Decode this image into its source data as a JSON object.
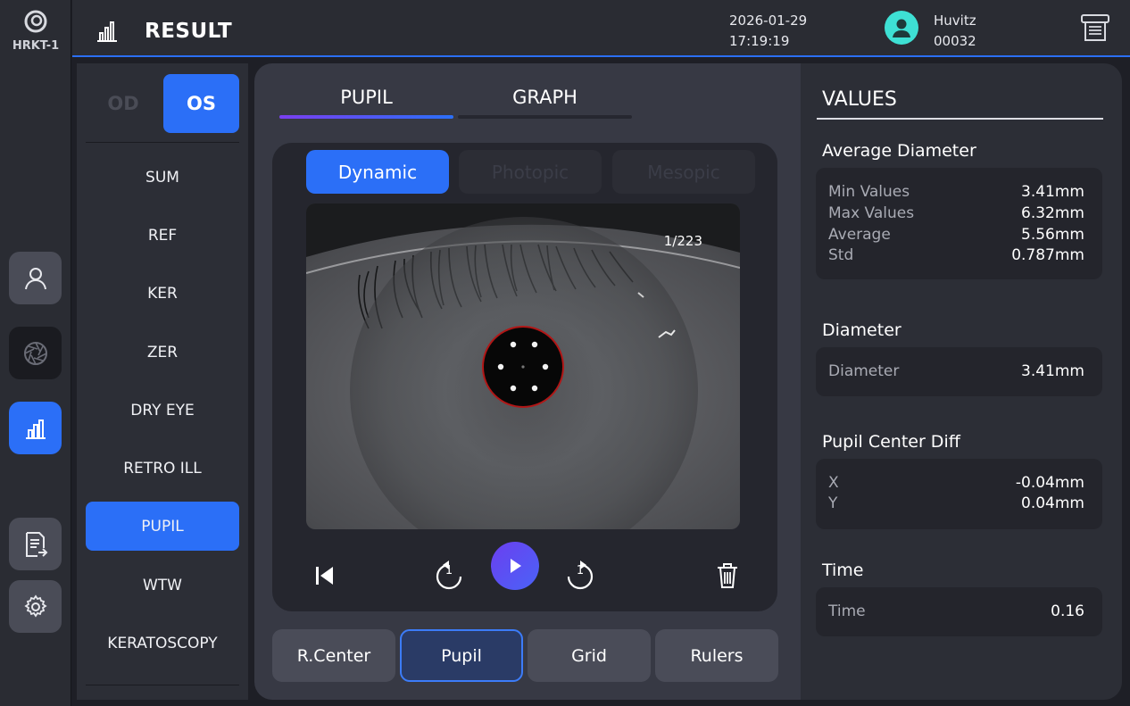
{
  "device": {
    "name": "HRKT-1",
    "logo_icon": "swirl-logo-icon"
  },
  "rail": [
    {
      "name": "user-icon"
    },
    {
      "name": "aperture-icon"
    },
    {
      "name": "chart-icon",
      "active": true
    },
    {
      "name": "report-icon"
    },
    {
      "name": "gear-icon"
    }
  ],
  "header": {
    "title": "RESULT",
    "date": "2026-01-29",
    "time": "17:19:19",
    "user_name": "Huvitz",
    "user_id": "00032",
    "accent": "#2b6ff7"
  },
  "eye": {
    "od": "OD",
    "os": "OS",
    "selected": "OS"
  },
  "menu": {
    "items": [
      {
        "label": "SUM"
      },
      {
        "label": "REF"
      },
      {
        "label": "KER"
      },
      {
        "label": "ZER"
      },
      {
        "label": "DRY EYE"
      },
      {
        "label": "RETRO ILL"
      },
      {
        "label": "PUPIL",
        "active": true
      },
      {
        "label": "WTW"
      },
      {
        "label": "KERATOSCOPY"
      }
    ]
  },
  "tabs": [
    {
      "label": "PUPIL",
      "active": true
    },
    {
      "label": "GRAPH"
    }
  ],
  "modes": [
    {
      "label": "Dynamic",
      "active": true
    },
    {
      "label": "Photopic"
    },
    {
      "label": "Mesopic"
    }
  ],
  "player": {
    "frame": "1/223",
    "skip_back_amount": "1",
    "skip_fwd_amount": "1"
  },
  "bottom": [
    {
      "label": "R.Center"
    },
    {
      "label": "Pupil",
      "active": true
    },
    {
      "label": "Grid"
    },
    {
      "label": "Rulers"
    }
  ],
  "values": {
    "title": "VALUES",
    "average_diameter": {
      "title": "Average Diameter",
      "rows": [
        {
          "k": "Min Values",
          "v": "3.41mm"
        },
        {
          "k": "Max Values",
          "v": "6.32mm"
        },
        {
          "k": "Average",
          "v": "5.56mm"
        },
        {
          "k": "Std",
          "v": "0.787mm"
        }
      ]
    },
    "diameter": {
      "title": "Diameter",
      "rows": [
        {
          "k": "Diameter",
          "v": "3.41mm"
        }
      ]
    },
    "pupil_center_diff": {
      "title": "Pupil Center Diff",
      "rows": [
        {
          "k": "X",
          "v": "-0.04mm"
        },
        {
          "k": "Y",
          "v": "0.04mm"
        }
      ]
    },
    "time": {
      "title": "Time",
      "rows": [
        {
          "k": "Time",
          "v": "0.16"
        }
      ]
    }
  }
}
